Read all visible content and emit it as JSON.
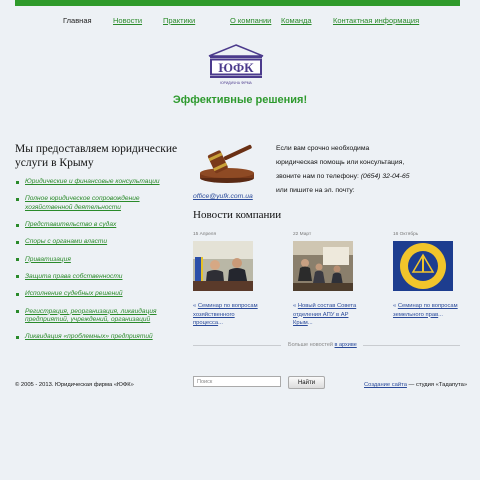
{
  "nav": {
    "items": [
      {
        "label": "Главная",
        "active": true
      },
      {
        "label": "Новости"
      },
      {
        "label": "Практики"
      },
      {
        "label": "О компании"
      },
      {
        "label": "Команда"
      },
      {
        "label": "Контактная информация"
      }
    ]
  },
  "logo": {
    "text": "ЮФК",
    "subtitle": "ЮРИДИЧНА ФІРМА"
  },
  "slogan": {
    "text": "Эффективные решения",
    "accent": "!"
  },
  "services": {
    "title": "Мы предоставляем юридические услуги в Крыму",
    "items": [
      "Юридические и финансовые консультации",
      "Полное юридическое сопровождение хозяйственной деятельности",
      "Представительство в судах",
      "Споры с органами власти",
      "Приватизация",
      "Защита права собственности",
      "Исполнение судебных решений",
      "Регистрация, реорганизация, ликвидация предприятий, учреждений, организаций",
      "Ликвидация «проблемных» предприятий"
    ]
  },
  "contact": {
    "line1": "Если вам срочно необходима",
    "line2": "юридическая помощь или консультация,",
    "line3_prefix": "звоните нам по телефону: ",
    "phone": "(0654) 32-04-65",
    "line4": "или пишите на эл. почту:",
    "email": "office@yufk.com.ua"
  },
  "news": {
    "title": "Новости компании",
    "items": [
      {
        "date": "15 Апреля",
        "prefix": "« ",
        "link": "Семинар по вопросам хозяйственного процесса",
        "suffix": "..."
      },
      {
        "date": "22 Март",
        "prefix": "« ",
        "link": "Новый состав Совета отделения АПУ в АР Крым",
        "suffix": "..."
      },
      {
        "date": "16 Октябрь",
        "prefix": "« ",
        "link": "Семинар по вопросам земельного прав",
        "suffix": "..."
      }
    ],
    "more_text": "Больше новостей ",
    "more_link": "в архиве"
  },
  "footer": {
    "copyright": "© 2005 - 2013. Юридическая фирма «ЮФК»",
    "search_placeholder": "Поиск",
    "search_button": "Найти",
    "credit_link": "Создание сайта",
    "credit_text": " — студия «Тадапута»"
  },
  "colors": {
    "brand_green": "#2f9a2b",
    "link_blue": "#2a4a9a",
    "logo_purple": "#4b3a8c"
  }
}
